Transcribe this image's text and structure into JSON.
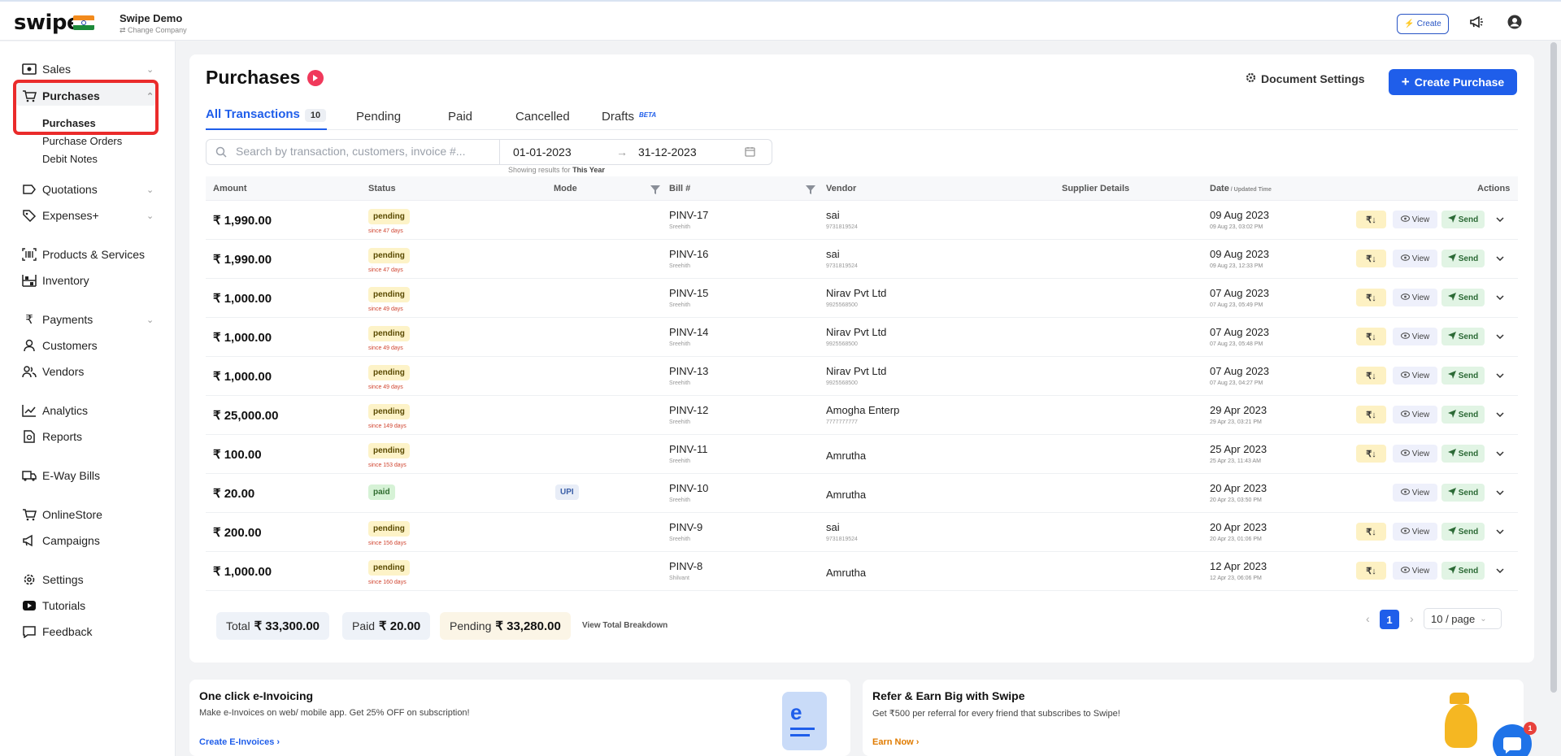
{
  "topbar": {
    "logo": "swipe",
    "company_name": "Swipe Demo",
    "change_company": "⇄ Change Company",
    "create_label": "Create"
  },
  "sidebar": {
    "items": [
      {
        "label": "Sales",
        "icon": "cash-icon"
      },
      {
        "label": "Purchases",
        "icon": "cart-icon"
      },
      {
        "label": "Quotations",
        "icon": "quote-icon"
      },
      {
        "label": "Expenses+",
        "icon": "tag-icon"
      },
      {
        "label": "Products & Services",
        "icon": "barcode-icon"
      },
      {
        "label": "Inventory",
        "icon": "inventory-icon"
      },
      {
        "label": "Payments",
        "icon": "rupee-icon"
      },
      {
        "label": "Customers",
        "icon": "user-icon"
      },
      {
        "label": "Vendors",
        "icon": "users-icon"
      },
      {
        "label": "Analytics",
        "icon": "chart-icon"
      },
      {
        "label": "Reports",
        "icon": "report-icon"
      },
      {
        "label": "E-Way Bills",
        "icon": "truck-icon"
      },
      {
        "label": "OnlineStore",
        "icon": "store-icon"
      },
      {
        "label": "Campaigns",
        "icon": "megaphone-icon"
      },
      {
        "label": "Settings",
        "icon": "gear-icon"
      },
      {
        "label": "Tutorials",
        "icon": "youtube-icon"
      },
      {
        "label": "Feedback",
        "icon": "feedback-icon"
      }
    ],
    "sub_items": [
      "Purchases",
      "Purchase Orders",
      "Debit Notes"
    ]
  },
  "main": {
    "title": "Purchases",
    "document_settings": "Document Settings",
    "create_purchase": "Create Purchase",
    "tabs": [
      {
        "label": "All Transactions",
        "count": "10"
      },
      {
        "label": "Pending"
      },
      {
        "label": "Paid"
      },
      {
        "label": "Cancelled"
      },
      {
        "label": "Drafts",
        "badge": "BETA"
      }
    ],
    "search_placeholder": "Search by transaction, customers, invoice #...",
    "date_from": "01-01-2023",
    "date_arrow": "→",
    "date_to": "31-12-2023",
    "showing_prefix": "Showing results for",
    "showing_value": "This Year",
    "columns": {
      "amount": "Amount",
      "status": "Status",
      "mode": "Mode",
      "bill": "Bill #",
      "vendor": "Vendor",
      "supplier": "Supplier Details",
      "date": "Date",
      "date_sub": " / Updated Time",
      "actions": "Actions"
    },
    "rows": [
      {
        "amount": "₹ 1,990.00",
        "status": "pending",
        "since": "since 47 days",
        "mode": "",
        "bill": "PINV-17",
        "bill_sub": "Sreehith",
        "vendor": "sai",
        "vendor_sub": "9731819524",
        "date": "09 Aug 2023",
        "date_sub": "09 Aug 23, 03:02 PM",
        "pay": true
      },
      {
        "amount": "₹ 1,990.00",
        "status": "pending",
        "since": "since 47 days",
        "mode": "",
        "bill": "PINV-16",
        "bill_sub": "Sreehith",
        "vendor": "sai",
        "vendor_sub": "9731819524",
        "date": "09 Aug 2023",
        "date_sub": "09 Aug 23, 12:33 PM",
        "pay": true
      },
      {
        "amount": "₹ 1,000.00",
        "status": "pending",
        "since": "since 49 days",
        "mode": "",
        "bill": "PINV-15",
        "bill_sub": "Sreehith",
        "vendor": "Nirav Pvt Ltd",
        "vendor_sub": "9925568500",
        "date": "07 Aug 2023",
        "date_sub": "07 Aug 23, 05:49 PM",
        "pay": true
      },
      {
        "amount": "₹ 1,000.00",
        "status": "pending",
        "since": "since 49 days",
        "mode": "",
        "bill": "PINV-14",
        "bill_sub": "Sreehith",
        "vendor": "Nirav Pvt Ltd",
        "vendor_sub": "9925568500",
        "date": "07 Aug 2023",
        "date_sub": "07 Aug 23, 05:48 PM",
        "pay": true
      },
      {
        "amount": "₹ 1,000.00",
        "status": "pending",
        "since": "since 49 days",
        "mode": "",
        "bill": "PINV-13",
        "bill_sub": "Sreehith",
        "vendor": "Nirav Pvt Ltd",
        "vendor_sub": "9925568500",
        "date": "07 Aug 2023",
        "date_sub": "07 Aug 23, 04:27 PM",
        "pay": true
      },
      {
        "amount": "₹ 25,000.00",
        "status": "pending",
        "since": "since 149 days",
        "mode": "",
        "bill": "PINV-12",
        "bill_sub": "Sreehith",
        "vendor": "Amogha Enterp",
        "vendor_sub": "7777777777",
        "date": "29 Apr 2023",
        "date_sub": "29 Apr 23, 03:21 PM",
        "pay": true
      },
      {
        "amount": "₹ 100.00",
        "status": "pending",
        "since": "since 153 days",
        "mode": "",
        "bill": "PINV-11",
        "bill_sub": "Sreehith",
        "vendor": "Amrutha",
        "vendor_sub": "",
        "date": "25 Apr 2023",
        "date_sub": "25 Apr 23, 11:43 AM",
        "pay": true
      },
      {
        "amount": "₹ 20.00",
        "status": "paid",
        "since": "",
        "mode": "UPI",
        "bill": "PINV-10",
        "bill_sub": "Sreehith",
        "vendor": "Amrutha",
        "vendor_sub": "",
        "date": "20 Apr 2023",
        "date_sub": "20 Apr 23, 03:50 PM",
        "pay": false
      },
      {
        "amount": "₹ 200.00",
        "status": "pending",
        "since": "since 156 days",
        "mode": "",
        "bill": "PINV-9",
        "bill_sub": "Sreehith",
        "vendor": "sai",
        "vendor_sub": "9731819524",
        "date": "20 Apr 2023",
        "date_sub": "20 Apr 23, 01:06 PM",
        "pay": true
      },
      {
        "amount": "₹ 1,000.00",
        "status": "pending",
        "since": "since 160 days",
        "mode": "",
        "bill": "PINV-8",
        "bill_sub": "Shilvant",
        "vendor": "Amrutha",
        "vendor_sub": "",
        "date": "12 Apr 2023",
        "date_sub": "12 Apr 23, 06:06 PM",
        "pay": true
      }
    ],
    "row_actions": {
      "pay": "₹↓",
      "view": "View",
      "send": "Send"
    },
    "summary": {
      "total_label": "Total",
      "total_value": "₹ 33,300.00",
      "paid_label": "Paid",
      "paid_value": "₹ 20.00",
      "pending_label": "Pending",
      "pending_value": "₹ 33,280.00",
      "breakdown": "View Total Breakdown"
    },
    "pagination": {
      "page": "1",
      "page_size": "10 / page"
    }
  },
  "promos": [
    {
      "title": "One click e-Invoicing",
      "desc": "Make e-Invoices on web/ mobile app. Get 25% OFF on subscription!",
      "link": "Create E-Invoices",
      "color": "#1f5eea"
    },
    {
      "title": "Refer & Earn Big with Swipe",
      "desc": "Get ₹500 per referral for every friend that subscribes to Swipe!",
      "link": "Earn Now",
      "color": "#e07b00"
    }
  ],
  "chat": {
    "badge": "1"
  },
  "colors": {
    "primary": "#1f5eea",
    "highlight": "#ea2b2b",
    "pending": "#fdf3c8",
    "paid": "#d6f2d6"
  }
}
